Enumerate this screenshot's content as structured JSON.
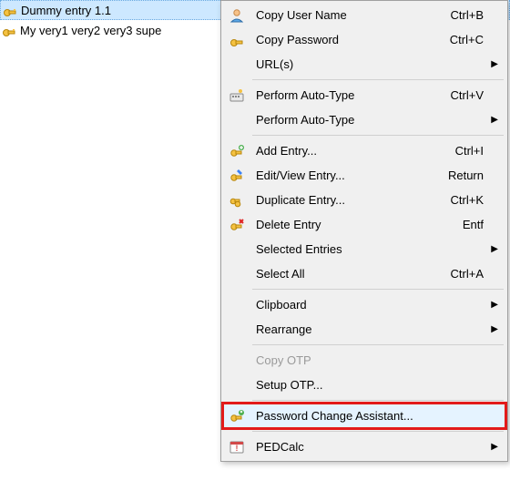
{
  "entries": [
    {
      "label": "Dummy entry 1.1",
      "selected": true
    },
    {
      "label": "My very1 very2 very3 supe",
      "selected": false
    }
  ],
  "menu": {
    "copy_user_name": "Copy User Name",
    "copy_password": "Copy Password",
    "urls": "URL(s)",
    "perform_auto_type": "Perform Auto-Type",
    "perform_auto_type_sub": "Perform Auto-Type",
    "add_entry": "Add Entry...",
    "edit_view_entry": "Edit/View Entry...",
    "duplicate_entry": "Duplicate Entry...",
    "delete_entry": "Delete Entry",
    "selected_entries": "Selected Entries",
    "select_all": "Select All",
    "clipboard": "Clipboard",
    "rearrange": "Rearrange",
    "copy_otp": "Copy OTP",
    "setup_otp": "Setup OTP...",
    "password_change_assistant": "Password Change Assistant...",
    "pedcalc": "PEDCalc"
  },
  "shortcuts": {
    "copy_user_name": "Ctrl+B",
    "copy_password": "Ctrl+C",
    "perform_auto_type": "Ctrl+V",
    "add_entry": "Ctrl+I",
    "edit_view_entry": "Return",
    "duplicate_entry": "Ctrl+K",
    "delete_entry": "Entf",
    "select_all": "Ctrl+A"
  }
}
